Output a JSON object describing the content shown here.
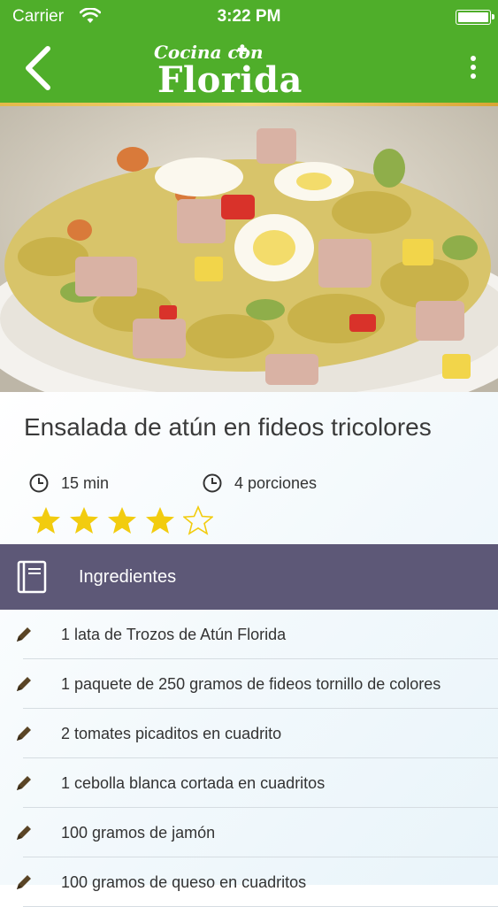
{
  "status_bar": {
    "carrier": "Carrier",
    "time": "3:22 PM"
  },
  "nav": {
    "logo_top": "Cocina con",
    "logo_main": "Florida",
    "brand_green": "#4fae2a",
    "back_icon": "chevron-left-icon",
    "menu_icon": "more-vertical-icon"
  },
  "recipe": {
    "title": "Ensalada de atún en fideos tricolores",
    "time": "15 min",
    "servings": "4 porciones",
    "rating": 4,
    "rating_max": 5,
    "star_color": "#f2cc0f"
  },
  "ingredients_section": {
    "label": "Ingredientes",
    "header_color": "#5d5877",
    "items": [
      "1 lata de Trozos de Atún Florida",
      "1 paquete de 250 gramos de fideos tornillo de colores",
      "2 tomates picaditos en cuadrito",
      "1 cebolla blanca cortada en cuadritos",
      "100 gramos de jamón",
      "100 gramos de queso en cuadritos"
    ]
  }
}
